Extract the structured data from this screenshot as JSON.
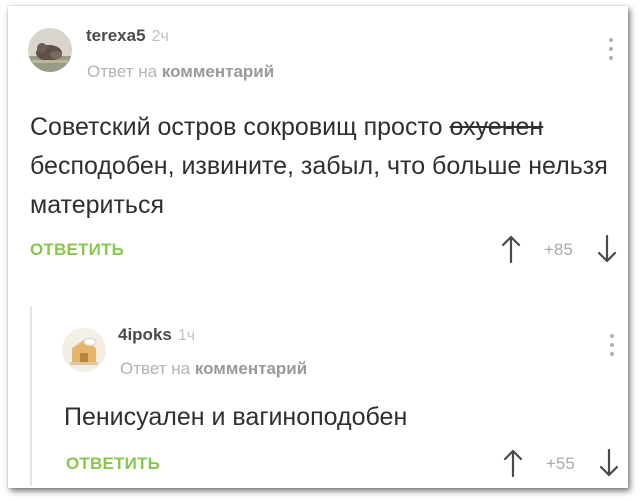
{
  "comments": [
    {
      "username": "terexa5",
      "time": "2ч",
      "reply_prefix": "Ответ на",
      "reply_target": "комментарий",
      "text_before_strike": "Советский остров сокровищ просто ",
      "text_struck": "охуенен",
      "text_after_strike": " бесподобен, извините, забыл, что больше нельзя материться",
      "reply_label": "ОТВЕТИТЬ",
      "score": "+85"
    },
    {
      "username": "4ipoks",
      "time": "1ч",
      "reply_prefix": "Ответ на",
      "reply_target": "комментарий",
      "text": "Пенисуален и вагиноподобен",
      "reply_label": "ОТВЕТИТЬ",
      "score": "+55"
    }
  ],
  "colors": {
    "accent_green": "#88c74f",
    "text": "#2f2f2f",
    "muted": "#b3b3b3"
  },
  "icons": [
    "avatar-terexa5",
    "avatar-4ipoks",
    "more-vertical-icon",
    "arrow-up-icon",
    "arrow-down-icon"
  ]
}
